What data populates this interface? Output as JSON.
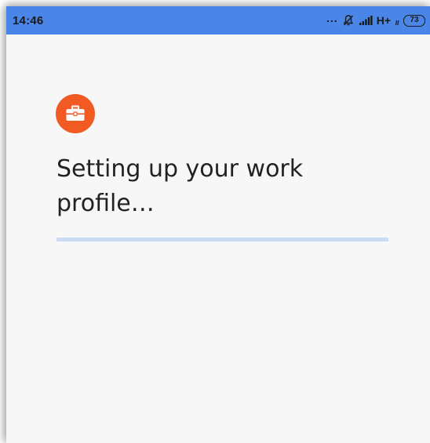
{
  "status_bar": {
    "time": "14:46",
    "dots": "...",
    "network": "H+",
    "battery_level": "73",
    "icons": [
      "notifications-off-icon",
      "signal-icon",
      "battery-icon"
    ],
    "background_color": "#4a86e8"
  },
  "setup": {
    "icon": "briefcase-icon",
    "icon_color": "#f25a24",
    "title": "Setting up your work profile…",
    "progress": 0,
    "progress_color": "#c9dcf4"
  }
}
